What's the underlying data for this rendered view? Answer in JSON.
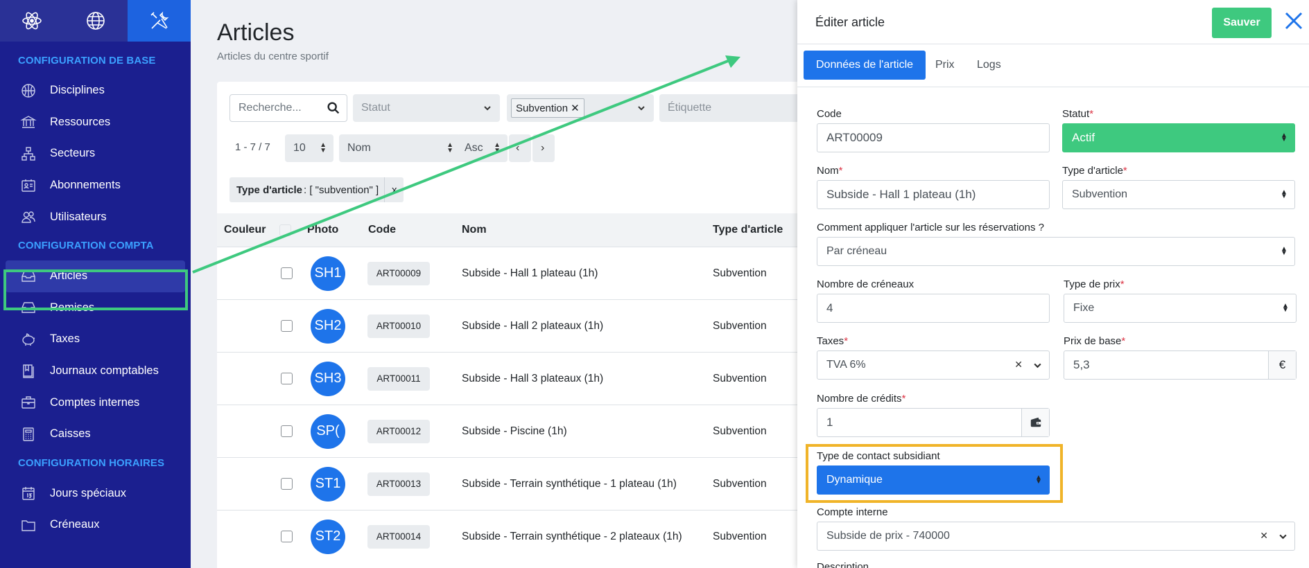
{
  "sidebar": {
    "tabs": [
      {
        "icon": "atom-icon",
        "active": false
      },
      {
        "icon": "globe-icon",
        "active": false
      },
      {
        "icon": "tools-icon",
        "active": true
      }
    ],
    "sections": [
      {
        "title": "CONFIGURATION DE BASE",
        "items": [
          {
            "label": "Disciplines",
            "icon": "basketball-icon"
          },
          {
            "label": "Ressources",
            "icon": "building-columns-icon"
          },
          {
            "label": "Secteurs",
            "icon": "sitemap-icon"
          },
          {
            "label": "Abonnements",
            "icon": "id-card-icon"
          },
          {
            "label": "Utilisateurs",
            "icon": "users-icon"
          }
        ]
      },
      {
        "title": "CONFIGURATION COMPTA",
        "items": [
          {
            "label": "Articles",
            "icon": "tray-icon",
            "active": true
          },
          {
            "label": "Remises",
            "icon": "tray-icon"
          },
          {
            "label": "Taxes",
            "icon": "piggy-bank-icon"
          },
          {
            "label": "Journaux comptables",
            "icon": "book-icon"
          },
          {
            "label": "Comptes internes",
            "icon": "briefcase-icon"
          },
          {
            "label": "Caisses",
            "icon": "calculator-icon"
          }
        ]
      },
      {
        "title": "CONFIGURATION HORAIRES",
        "items": [
          {
            "label": "Jours spéciaux",
            "icon": "calendar-icon"
          },
          {
            "label": "Créneaux",
            "icon": "folder-icon"
          }
        ]
      }
    ]
  },
  "main": {
    "title": "Articles",
    "subtitle": "Articles du centre sportif",
    "filters": {
      "search_placeholder": "Recherche...",
      "statut_placeholder": "Statut",
      "type_tag": "Subvention",
      "etiquette_placeholder": "Étiquette"
    },
    "pagination": {
      "count": "1 - 7 / 7",
      "per_page": "10",
      "sort_field": "Nom",
      "sort_order": "Asc"
    },
    "active_filter": {
      "key": "Type d'article",
      "value": ": [ \"subvention\" ]",
      "remove": "x"
    },
    "columns": [
      "Couleur",
      "Photo",
      "Code",
      "Nom",
      "Type d'article"
    ],
    "rows": [
      {
        "avatar": "SH1",
        "code": "ART00009",
        "name": "Subside - Hall 1 plateau (1h)",
        "type": "Subvention"
      },
      {
        "avatar": "SH2",
        "code": "ART00010",
        "name": "Subside - Hall 2 plateaux (1h)",
        "type": "Subvention"
      },
      {
        "avatar": "SH3",
        "code": "ART00011",
        "name": "Subside - Hall 3 plateaux (1h)",
        "type": "Subvention"
      },
      {
        "avatar": "SP(",
        "code": "ART00012",
        "name": "Subside - Piscine (1h)",
        "type": "Subvention"
      },
      {
        "avatar": "ST1",
        "code": "ART00013",
        "name": "Subside - Terrain synthétique - 1 plateau (1h)",
        "type": "Subvention"
      },
      {
        "avatar": "ST2",
        "code": "ART00014",
        "name": "Subside - Terrain synthétique - 2 plateaux (1h)",
        "type": "Subvention"
      }
    ]
  },
  "drawer": {
    "title": "Éditer article",
    "save_label": "Sauver",
    "tabs": [
      "Données de l'article",
      "Prix",
      "Logs"
    ],
    "fields": {
      "code_label": "Code",
      "code_value": "ART00009",
      "statut_label": "Statut",
      "statut_value": "Actif",
      "nom_label": "Nom",
      "nom_value": "Subside - Hall 1 plateau (1h)",
      "type_label": "Type d'article",
      "type_value": "Subvention",
      "apply_label": "Comment appliquer l'article sur les réservations ?",
      "apply_value": "Par créneau",
      "creneaux_label": "Nombre de créneaux",
      "creneaux_value": "4",
      "prix_type_label": "Type de prix",
      "prix_type_value": "Fixe",
      "taxes_label": "Taxes",
      "taxes_value": "TVA 6%",
      "prix_base_label": "Prix de base",
      "prix_base_value": "5,3",
      "currency": "€",
      "credits_label": "Nombre de crédits",
      "credits_value": "1",
      "contact_label": "Type de contact subsidiant",
      "contact_value": "Dynamique",
      "compte_label": "Compte interne",
      "compte_value": "Subside de prix - 740000",
      "description_label": "Description"
    },
    "required_mark": "*"
  },
  "colors": {
    "sidebar_bg": "#1b1f8f",
    "accent_blue": "#1e74ea",
    "success_green": "#3ec97f",
    "highlight_orange": "#f0b429",
    "section_title": "#3ba0ff"
  }
}
